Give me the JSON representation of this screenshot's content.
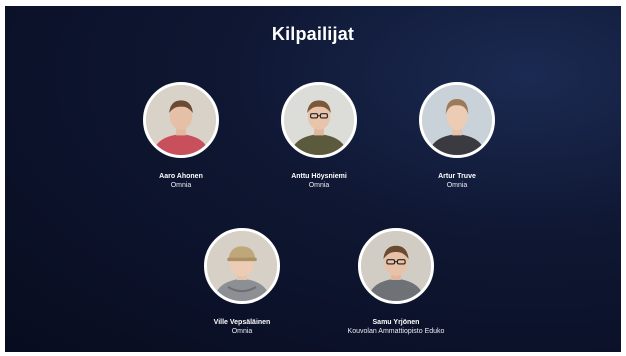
{
  "slide": {
    "title": "Kilpailijat",
    "contestants": [
      {
        "name": "Aaro Ahonen",
        "school": "Omnia",
        "photo": "portrait-hoodie-red",
        "colors": {
          "shirt": "#c8505c",
          "hair": "#6a4a32",
          "bg": "#d8d2c8"
        }
      },
      {
        "name": "Anttu Höysniemi",
        "school": "Omnia",
        "photo": "portrait-glasses-olive",
        "colors": {
          "shirt": "#5c5a3c",
          "hair": "#7a5838",
          "bg": "#dcdcd8"
        }
      },
      {
        "name": "Artur Truve",
        "school": "Omnia",
        "photo": "portrait-dark-shirt",
        "colors": {
          "shirt": "#3a3a40",
          "hair": "#9a7a58",
          "bg": "#c8d2d8"
        }
      },
      {
        "name": "Ville Vepsäläinen",
        "school": "Omnia",
        "photo": "portrait-cap-hoodie",
        "colors": {
          "shirt": "#8c8f94",
          "hair": "#bfa77a",
          "bg": "#d6d0c6"
        }
      },
      {
        "name": "Samu Yrjönen",
        "school": "Kouvolan Ammattiopisto Eduko",
        "photo": "portrait-glasses-grey",
        "colors": {
          "shirt": "#6e7276",
          "hair": "#6a4a30",
          "bg": "#d2cdc4"
        }
      }
    ]
  }
}
